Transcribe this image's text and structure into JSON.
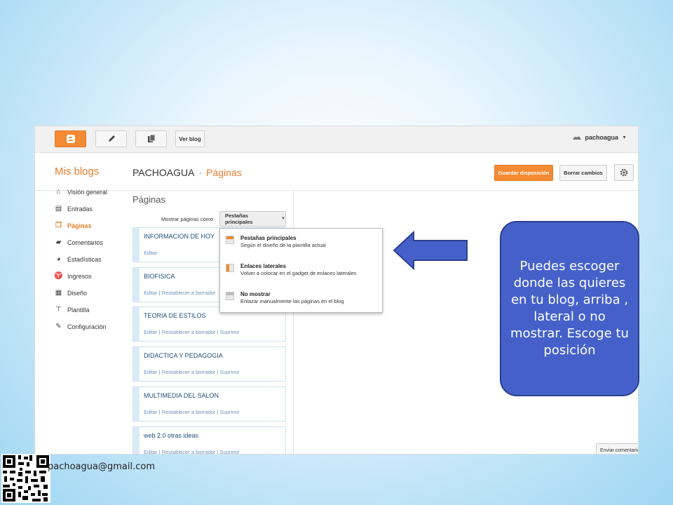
{
  "topbar": {
    "view_blog": "Ver blog",
    "user": "pachoagua"
  },
  "header": {
    "my_blogs": "Mis blogs",
    "blog_name": "PACHOAGUA",
    "separator": "·",
    "section": "Páginas",
    "save_layout": "Guardar disposición",
    "clear_changes": "Borrar cambios"
  },
  "sidebar": {
    "items": [
      {
        "label": "Visión general",
        "icon": "home-icon"
      },
      {
        "label": "Entradas",
        "icon": "posts-icon"
      },
      {
        "label": "Páginas",
        "icon": "pages-icon"
      },
      {
        "label": "Comentarios",
        "icon": "comment-icon"
      },
      {
        "label": "Estadísticas",
        "icon": "stats-icon"
      },
      {
        "label": "Ingresos",
        "icon": "trophy-icon"
      },
      {
        "label": "Diseño",
        "icon": "layout-icon"
      },
      {
        "label": "Plantilla",
        "icon": "template-icon"
      },
      {
        "label": "Configuración",
        "icon": "wrench-icon"
      }
    ]
  },
  "main": {
    "heading": "Páginas",
    "show_as_label": "Mostrar páginas como",
    "show_as_value": "Pestañas principales",
    "pages": [
      {
        "title": "INFORMACION DE HOY",
        "actions": "Editar"
      },
      {
        "title": "BIOFISICA",
        "actions": "Editar | Restablecer a borrador"
      },
      {
        "title": "TEORIA DE ESTILOS",
        "actions": "Editar | Restablecer a borrador | Suprimir"
      },
      {
        "title": "DIDACTICA Y PEDAGOGIA",
        "actions": "Editar | Restablecer a borrador | Suprimir"
      },
      {
        "title": "MULTIMEDIA DEL SALON",
        "actions": "Editar | Restablecer a borrador | Suprimir"
      },
      {
        "title": "web 2.0 otras ideas",
        "actions": "Editar | Restablecer a borrador | Suprimir"
      }
    ]
  },
  "dropdown": {
    "options": [
      {
        "title": "Pestañas principales",
        "desc": "Según el diseño de la plantilla actual"
      },
      {
        "title": "Enlaces laterales",
        "desc": "Volver a colocar en el gadget de enlaces laterales"
      },
      {
        "title": "No mostrar",
        "desc": "Enlazar manualmente las páginas en el blog"
      }
    ]
  },
  "feedback": "Enviar comentarios",
  "callout": "Puedes escoger donde las quieres en tu blog, arriba , lateral o no mostrar. Escoge tu posición",
  "email": "pachoagua@gmail.com",
  "colors": {
    "accent": "#f48a33",
    "callout": "#4561c9",
    "link": "#1f4e79"
  }
}
